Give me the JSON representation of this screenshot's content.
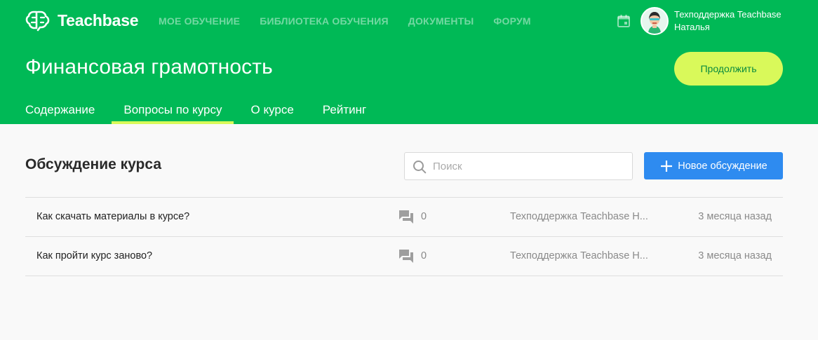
{
  "colors": {
    "brand_green": "#00b956",
    "accent_lime": "#d9f95a",
    "primary_blue": "#2e8bf0",
    "page_bg": "#f9f9f9"
  },
  "header": {
    "logo_text": "Teachbase",
    "nav": [
      {
        "label": "МОЕ ОБУЧЕНИЕ"
      },
      {
        "label": "БИБЛИОТЕКА ОБУЧЕНИЯ"
      },
      {
        "label": "ДОКУМЕНТЫ"
      },
      {
        "label": "ФОРУМ"
      }
    ],
    "icons": {
      "calendar": "calendar-icon",
      "avatar": "avatar"
    },
    "user": {
      "name": "Техподдержка Teachbase",
      "subtitle": "Наталья"
    }
  },
  "course": {
    "title": "Финансовая грамотность",
    "continue_label": "Продолжить",
    "tabs": [
      {
        "label": "Содержание",
        "active": false
      },
      {
        "label": "Вопросы по курсу",
        "active": true
      },
      {
        "label": "О курсе",
        "active": false
      },
      {
        "label": "Рейтинг",
        "active": false
      }
    ]
  },
  "discussions": {
    "title": "Обсуждение курса",
    "search_placeholder": "Поиск",
    "new_button_label": "Новое обсуждение",
    "rows": [
      {
        "title": "Как скачать материалы в курсе?",
        "count": "0",
        "author": "Техподдержка Teachbase Н...",
        "date": "3 месяца назад"
      },
      {
        "title": "Как пройти курс заново?",
        "count": "0",
        "author": "Техподдержка Teachbase Н...",
        "date": "3 месяца назад"
      }
    ]
  }
}
